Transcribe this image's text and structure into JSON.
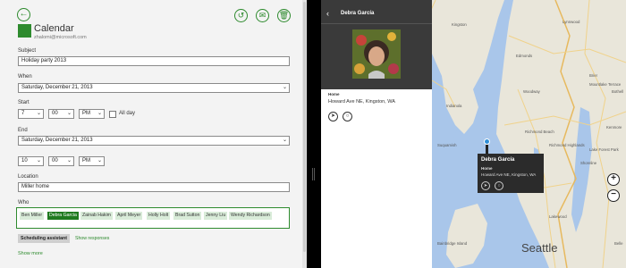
{
  "calendar": {
    "app_title": "Calendar",
    "account": "zhalomi@microsoft.com",
    "subject_label": "Subject",
    "subject_value": "Holiday party 2013",
    "when_label": "When",
    "when_value": "Saturday, December 21, 2013",
    "start_label": "Start",
    "start_hour": "7",
    "start_minute": "00",
    "start_ampm": "PM",
    "all_day_label": "All day",
    "end_label": "End",
    "end_date": "Saturday, December 21, 2013",
    "end_hour": "10",
    "end_minute": "00",
    "end_ampm": "PM",
    "location_label": "Location",
    "location_value": "Miller home",
    "who_label": "Who",
    "attendees": [
      "Ben Miller",
      "Debra Garcia",
      "Zainab Hakim",
      "April Meyer",
      "Holly Holt",
      "Brad Sutton",
      "Jenny Liu",
      "Wendy Richardson"
    ],
    "scheduling_assistant": "Scheduling assistant",
    "show_responses": "Show responses",
    "show_more": "Show more",
    "accent_color": "#2e8b2e"
  },
  "contact_card": {
    "name": "Debra García",
    "home_label": "Home",
    "address": "Howard Ave NE, Kingston, WA"
  },
  "map": {
    "popup_name": "Debra García",
    "popup_home": "Home",
    "popup_address": "Howard Ave NE, Kingston, WA",
    "city": "Seattle",
    "places": {
      "kingston": "Kingston",
      "suquamish": "Suquamish",
      "indianola": "Indianola",
      "poulsbo": "Poulsbo",
      "lynnwood": "Lynnwood",
      "edmonds": "Edmonds",
      "brier": "Brier",
      "woodway": "Woodway",
      "bothell": "Bothell",
      "mountlake_terrace": "Mountlake Terrace",
      "shoreline": "Shoreline",
      "richmond_beach": "Richmond Beach",
      "richmond_highlands": "Richmond Highlands",
      "lake_forest_park": "Lake Forest Park",
      "kenmore": "Kenmore",
      "keystone": "Keystone",
      "bainbridge_island": "Bainbridge Island",
      "seattle_short": "Seattle",
      "lakewood": "Lakewood",
      "bellevue": "Belle"
    }
  }
}
